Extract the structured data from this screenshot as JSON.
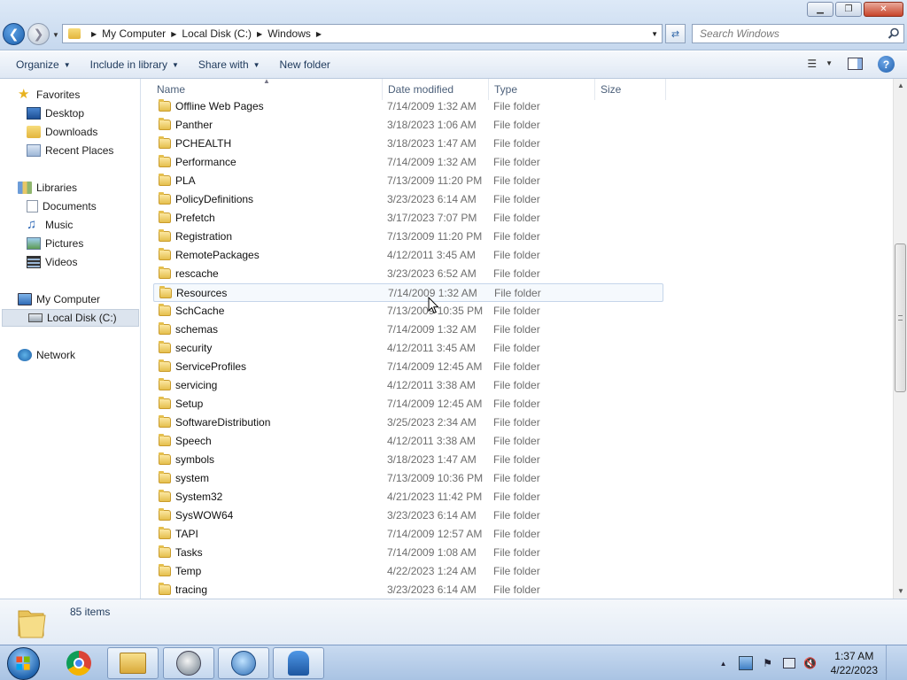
{
  "window": {
    "minimize_glyph": "▁",
    "maximize_glyph": "❐",
    "close_glyph": "✕"
  },
  "address": {
    "crumbs": [
      "My Computer",
      "Local Disk (C:)",
      "Windows"
    ],
    "search_placeholder": "Search Windows"
  },
  "toolbar": {
    "organize": "Organize",
    "include_in_library": "Include in library",
    "share_with": "Share with",
    "new_folder": "New folder",
    "help_glyph": "?"
  },
  "nav": {
    "favorites": "Favorites",
    "desktop": "Desktop",
    "downloads": "Downloads",
    "recent_places": "Recent Places",
    "libraries": "Libraries",
    "documents": "Documents",
    "music": "Music",
    "pictures": "Pictures",
    "videos": "Videos",
    "my_computer": "My Computer",
    "local_disk": "Local Disk (C:)",
    "network": "Network"
  },
  "columns": {
    "name": "Name",
    "date_modified": "Date modified",
    "type": "Type",
    "size": "Size"
  },
  "files": [
    {
      "name": "Offline Web Pages",
      "date": "7/14/2009 1:32 AM",
      "type": "File folder"
    },
    {
      "name": "Panther",
      "date": "3/18/2023 1:06 AM",
      "type": "File folder"
    },
    {
      "name": "PCHEALTH",
      "date": "3/18/2023 1:47 AM",
      "type": "File folder"
    },
    {
      "name": "Performance",
      "date": "7/14/2009 1:32 AM",
      "type": "File folder"
    },
    {
      "name": "PLA",
      "date": "7/13/2009 11:20 PM",
      "type": "File folder"
    },
    {
      "name": "PolicyDefinitions",
      "date": "3/23/2023 6:14 AM",
      "type": "File folder"
    },
    {
      "name": "Prefetch",
      "date": "3/17/2023 7:07 PM",
      "type": "File folder"
    },
    {
      "name": "Registration",
      "date": "7/13/2009 11:20 PM",
      "type": "File folder"
    },
    {
      "name": "RemotePackages",
      "date": "4/12/2011 3:45 AM",
      "type": "File folder"
    },
    {
      "name": "rescache",
      "date": "3/23/2023 6:52 AM",
      "type": "File folder"
    },
    {
      "name": "Resources",
      "date": "7/14/2009 1:32 AM",
      "type": "File folder"
    },
    {
      "name": "SchCache",
      "date": "7/13/2009 10:35 PM",
      "type": "File folder"
    },
    {
      "name": "schemas",
      "date": "7/14/2009 1:32 AM",
      "type": "File folder"
    },
    {
      "name": "security",
      "date": "4/12/2011 3:45 AM",
      "type": "File folder"
    },
    {
      "name": "ServiceProfiles",
      "date": "7/14/2009 12:45 AM",
      "type": "File folder"
    },
    {
      "name": "servicing",
      "date": "4/12/2011 3:38 AM",
      "type": "File folder"
    },
    {
      "name": "Setup",
      "date": "7/14/2009 12:45 AM",
      "type": "File folder"
    },
    {
      "name": "SoftwareDistribution",
      "date": "3/25/2023 2:34 AM",
      "type": "File folder"
    },
    {
      "name": "Speech",
      "date": "4/12/2011 3:38 AM",
      "type": "File folder"
    },
    {
      "name": "symbols",
      "date": "3/18/2023 1:47 AM",
      "type": "File folder"
    },
    {
      "name": "system",
      "date": "7/13/2009 10:36 PM",
      "type": "File folder"
    },
    {
      "name": "System32",
      "date": "4/21/2023 11:42 PM",
      "type": "File folder"
    },
    {
      "name": "SysWOW64",
      "date": "3/23/2023 6:14 AM",
      "type": "File folder"
    },
    {
      "name": "TAPI",
      "date": "7/14/2009 12:57 AM",
      "type": "File folder"
    },
    {
      "name": "Tasks",
      "date": "7/14/2009 1:08 AM",
      "type": "File folder"
    },
    {
      "name": "Temp",
      "date": "4/22/2023 1:24 AM",
      "type": "File folder"
    },
    {
      "name": "tracing",
      "date": "3/23/2023 6:14 AM",
      "type": "File folder"
    }
  ],
  "hover_row_index": 10,
  "details": {
    "item_count": "85 items"
  },
  "taskbar": {
    "time": "1:37 AM",
    "date": "4/22/2023"
  }
}
